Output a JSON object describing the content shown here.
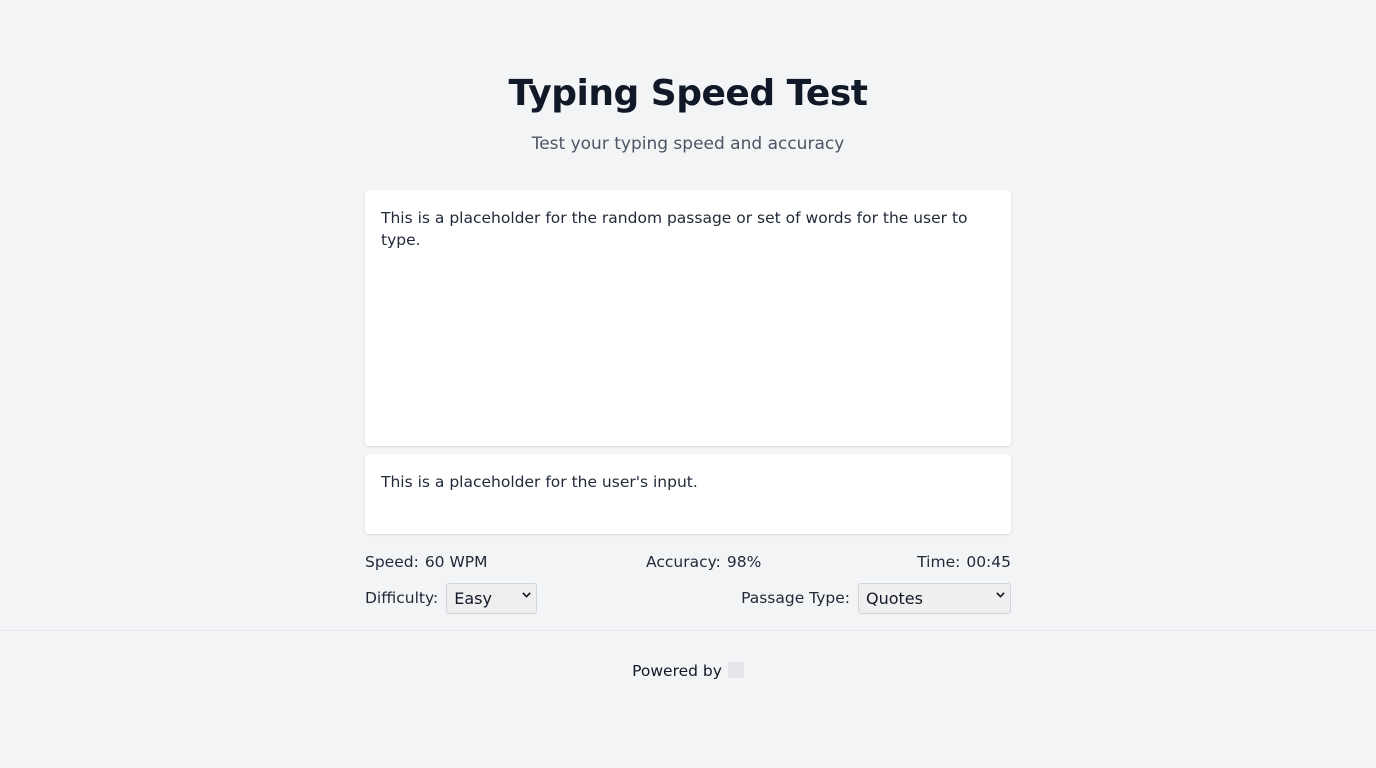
{
  "header": {
    "title": "Typing Speed Test",
    "subtitle": "Test your typing speed and accuracy"
  },
  "passage": {
    "text": "This is a placeholder for the random passage or set of words for the user to type."
  },
  "input": {
    "text": "This is a placeholder for the user's input."
  },
  "stats": {
    "speed_label": "Speed:",
    "speed_value": "60 WPM",
    "accuracy_label": "Accuracy:",
    "accuracy_value": "98%",
    "time_label": "Time:",
    "time_value": "00:45"
  },
  "controls": {
    "difficulty_label": "Difficulty:",
    "difficulty_selected": "Easy",
    "passage_type_label": "Passage Type:",
    "passage_type_selected": "Quotes"
  },
  "footer": {
    "powered_by": "Powered by",
    "logo_icon": "logo-icon"
  },
  "colors": {
    "background": "#f3f4f6",
    "card": "#ffffff",
    "title": "#111827",
    "subtitle": "#4b5563"
  }
}
